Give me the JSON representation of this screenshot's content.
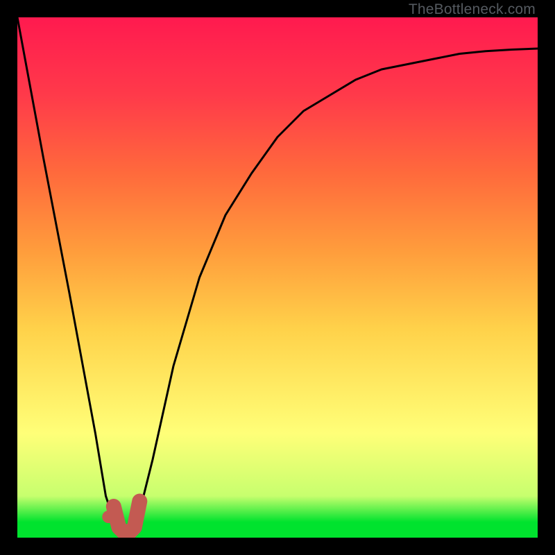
{
  "watermark": "TheBottleneck.com",
  "chart_data": {
    "type": "line",
    "title": "",
    "xlabel": "",
    "ylabel": "",
    "xlim": [
      0,
      100
    ],
    "ylim": [
      0,
      100
    ],
    "series": [
      {
        "name": "bottleneck-curve",
        "x": [
          0,
          5,
          10,
          15,
          17,
          19,
          21,
          23,
          26,
          30,
          35,
          40,
          45,
          50,
          55,
          60,
          65,
          70,
          75,
          80,
          85,
          90,
          95,
          100
        ],
        "y": [
          100,
          73,
          47,
          20,
          8,
          2,
          0,
          3,
          15,
          33,
          50,
          62,
          70,
          77,
          82,
          85,
          88,
          90,
          91,
          92,
          93,
          93.5,
          93.8,
          94
        ]
      }
    ],
    "marker": {
      "x": 17.5,
      "y": 4
    },
    "hook": {
      "x": [
        18.5,
        19.5,
        21,
        22.5,
        23.5
      ],
      "y": [
        6,
        2,
        0.5,
        2,
        7
      ]
    },
    "accent_color": "#c35a52",
    "background": "gradient-green-to-red"
  }
}
